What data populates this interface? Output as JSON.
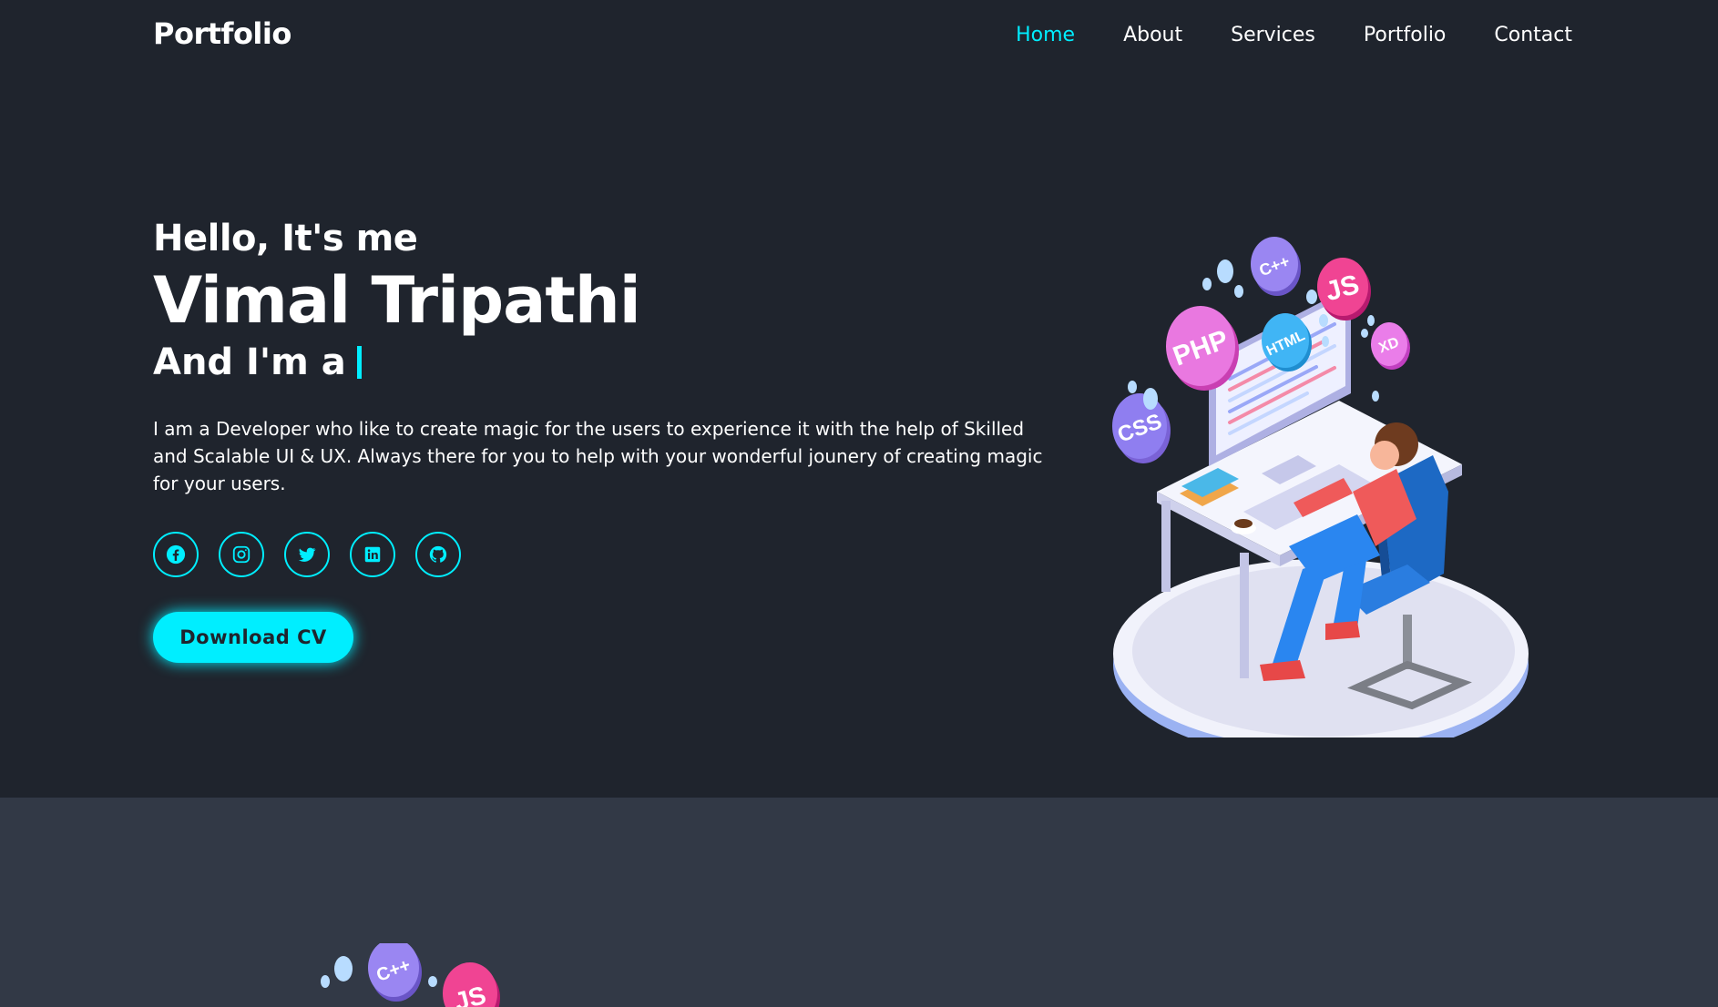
{
  "header": {
    "logo": "Portfolio",
    "nav": [
      {
        "label": "Home",
        "active": true
      },
      {
        "label": "About",
        "active": false
      },
      {
        "label": "Services",
        "active": false
      },
      {
        "label": "Portfolio",
        "active": false
      },
      {
        "label": "Contact",
        "active": false
      }
    ]
  },
  "hero": {
    "greeting": "Hello, It's me",
    "name": "Vimal Tripathi",
    "role_prefix": "And I'm a",
    "description": "I am a Developer who like to create magic for the users to experience it with the help of Skilled and Scalable UI & UX. Always there for you to help with your wonderful jounery of creating magic for your users.",
    "socials": [
      {
        "icon": "facebook-icon"
      },
      {
        "icon": "instagram-icon"
      },
      {
        "icon": "twitter-icon"
      },
      {
        "icon": "linkedin-icon"
      },
      {
        "icon": "github-icon"
      }
    ],
    "cta_label": "Download CV",
    "illustration_bubbles": [
      "C++",
      "JS",
      "PHP",
      "HTML",
      "XD",
      "CSS"
    ]
  },
  "colors": {
    "background": "#1f242d",
    "section_alt": "#323946",
    "accent": "#00eeff",
    "text": "#ffffff"
  }
}
